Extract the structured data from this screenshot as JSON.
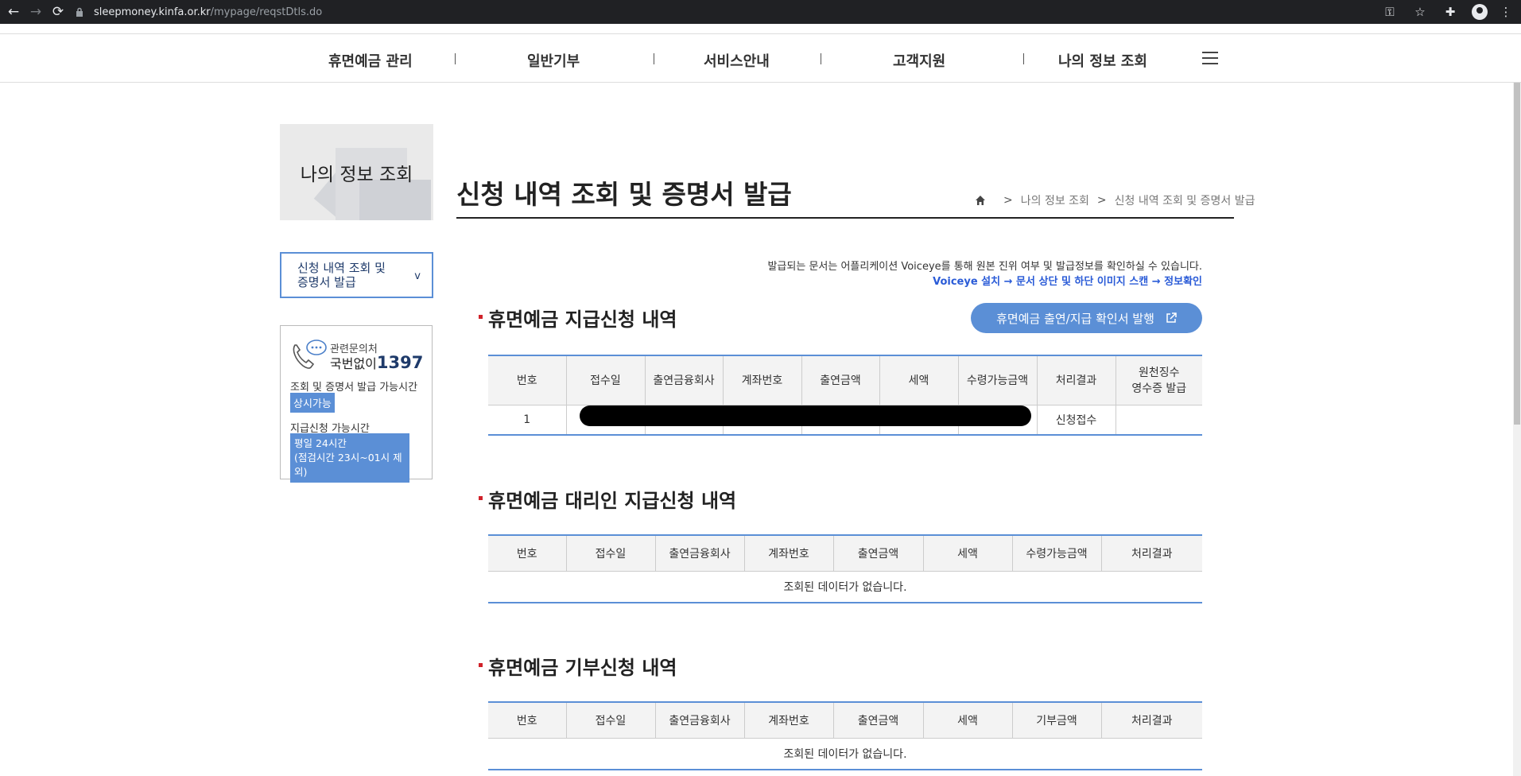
{
  "browser": {
    "url_host": "sleepmoney.kinfa.or.kr",
    "url_path": "/mypage/reqstDtls.do"
  },
  "gnb": {
    "items": [
      "휴면예금 관리",
      "일반기부",
      "서비스안내",
      "고객지원",
      "나의 정보 조회"
    ]
  },
  "lnb": {
    "title": "나의 정보 조회",
    "menu_line1": "신청 내역 조회 및",
    "menu_line2": "증명서 발급",
    "menu_chevron": "v"
  },
  "info_box": {
    "line1": "관련문의처",
    "line2_prefix": "국번없이",
    "phone": "1397",
    "line3": "조회 및 증명서 발급 가능시간",
    "badge1": "상시가능",
    "line4": "지급신청 가능시간",
    "badge2_line1": "평일 24시간",
    "badge2_line2": "(점검시간 23시~01시 제외)"
  },
  "page": {
    "title": "신청 내역 조회 및 증명서 발급",
    "breadcrumb": [
      "나의 정보 조회",
      "신청 내역 조회 및 증명서 발급"
    ],
    "breadcrumb_sep": ">",
    "notice1": "발급되는 문서는 어플리케이션 Voiceye를 통해 원본 진위 여부 및 발급정보를 확인하실 수 있습니다.",
    "notice2": "Voiceye 설치 → 문서 상단 및 하단 이미지 스캔 → 정보확인"
  },
  "section1": {
    "title": "휴면예금 지급신청 내역",
    "button": "휴면예금 출연/지급 확인서 발행",
    "headers": [
      "번호",
      "접수일",
      "출연금융회사",
      "계좌번호",
      "출연금액",
      "세액",
      "수령가능금액",
      "처리결과",
      "원천징수",
      "영수증 발급"
    ],
    "row": {
      "no": "1",
      "result": "신청접수"
    }
  },
  "section2": {
    "title": "휴면예금 대리인 지급신청 내역",
    "headers": [
      "번호",
      "접수일",
      "출연금융회사",
      "계좌번호",
      "출연금액",
      "세액",
      "수령가능금액",
      "처리결과"
    ],
    "empty": "조회된 데이터가 없습니다."
  },
  "section3": {
    "title": "휴면예금 기부신청 내역",
    "headers": [
      "번호",
      "접수일",
      "출연금융회사",
      "계좌번호",
      "출연금액",
      "세액",
      "기부금액",
      "처리결과"
    ],
    "empty": "조회된 데이터가 없습니다."
  }
}
